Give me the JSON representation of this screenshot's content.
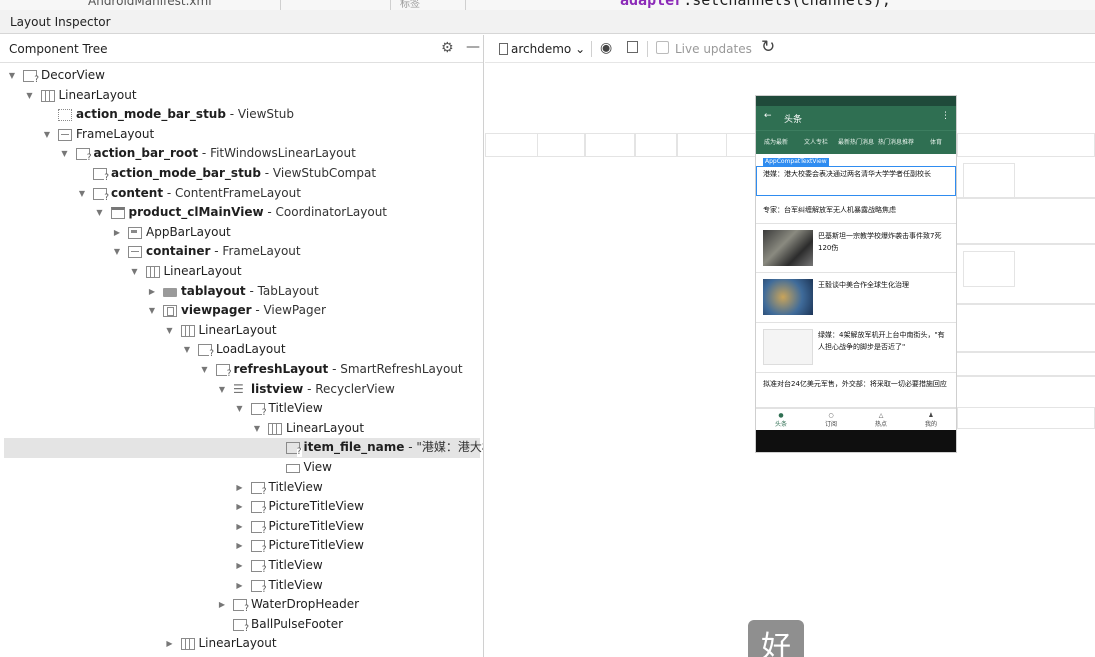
{
  "editor": {
    "file_tab": "AndroidManifest.xml",
    "cn_hint": "标签",
    "code_keyword": "adapter",
    "code_rest": ".setChannels(channels);"
  },
  "tool_window": {
    "title": "Layout Inspector"
  },
  "component_tree": {
    "header": "Component Tree",
    "rows": [
      {
        "depth": 0,
        "toggle": "▼",
        "icon": "q",
        "name": "DecorView",
        "bold": false,
        "cls": ""
      },
      {
        "depth": 1,
        "toggle": "▼",
        "icon": "lin",
        "name": "LinearLayout",
        "bold": false,
        "cls": ""
      },
      {
        "depth": 2,
        "toggle": "",
        "icon": "stub",
        "name": "action_mode_bar_stub",
        "bold": true,
        "cls": " - ViewStub"
      },
      {
        "depth": 2,
        "toggle": "▼",
        "icon": "frame",
        "name": "FrameLayout",
        "bold": false,
        "cls": ""
      },
      {
        "depth": 3,
        "toggle": "▼",
        "icon": "q",
        "name": "action_bar_root",
        "bold": true,
        "cls": " - FitWindowsLinearLayout"
      },
      {
        "depth": 4,
        "toggle": "",
        "icon": "q",
        "name": "action_mode_bar_stub",
        "bold": true,
        "cls": " - ViewStubCompat"
      },
      {
        "depth": 4,
        "toggle": "▼",
        "icon": "q",
        "name": "content",
        "bold": true,
        "cls": " - ContentFrameLayout"
      },
      {
        "depth": 5,
        "toggle": "▼",
        "icon": "coord",
        "name": "product_clMainView",
        "bold": true,
        "cls": " - CoordinatorLayout"
      },
      {
        "depth": 6,
        "toggle": "▶",
        "icon": "bar",
        "name": "AppBarLayout",
        "bold": false,
        "cls": ""
      },
      {
        "depth": 6,
        "toggle": "▼",
        "icon": "frame",
        "name": "container",
        "bold": true,
        "cls": " - FrameLayout"
      },
      {
        "depth": 7,
        "toggle": "▼",
        "icon": "lin",
        "name": "LinearLayout",
        "bold": false,
        "cls": ""
      },
      {
        "depth": 8,
        "toggle": "▶",
        "icon": "folder",
        "name": "tablayout",
        "bold": true,
        "cls": " - TabLayout"
      },
      {
        "depth": 8,
        "toggle": "▼",
        "icon": "pager",
        "name": "viewpager",
        "bold": true,
        "cls": " - ViewPager"
      },
      {
        "depth": 9,
        "toggle": "▼",
        "icon": "lin",
        "name": "LinearLayout",
        "bold": false,
        "cls": ""
      },
      {
        "depth": 10,
        "toggle": "▼",
        "icon": "q",
        "name": "LoadLayout",
        "bold": false,
        "cls": ""
      },
      {
        "depth": 11,
        "toggle": "▼",
        "icon": "q",
        "name": "refreshLayout",
        "bold": true,
        "cls": " - SmartRefreshLayout"
      },
      {
        "depth": 12,
        "toggle": "▼",
        "icon": "list",
        "name": "listview",
        "bold": true,
        "cls": " - RecyclerView"
      },
      {
        "depth": 13,
        "toggle": "▼",
        "icon": "q",
        "name": "TitleView",
        "bold": false,
        "cls": ""
      },
      {
        "depth": 14,
        "toggle": "▼",
        "icon": "lin",
        "name": "LinearLayout",
        "bold": false,
        "cls": ""
      },
      {
        "depth": 15,
        "toggle": "",
        "icon": "q",
        "name": "item_file_name",
        "bold": true,
        "cls": " - \"港媒：港大校",
        "selected": true
      },
      {
        "depth": 15,
        "toggle": "",
        "icon": "view",
        "name": "View",
        "bold": false,
        "cls": ""
      },
      {
        "depth": 13,
        "toggle": "▶",
        "icon": "q",
        "name": "TitleView",
        "bold": false,
        "cls": ""
      },
      {
        "depth": 13,
        "toggle": "▶",
        "icon": "q",
        "name": "PictureTitleView",
        "bold": false,
        "cls": ""
      },
      {
        "depth": 13,
        "toggle": "▶",
        "icon": "q",
        "name": "PictureTitleView",
        "bold": false,
        "cls": ""
      },
      {
        "depth": 13,
        "toggle": "▶",
        "icon": "q",
        "name": "PictureTitleView",
        "bold": false,
        "cls": ""
      },
      {
        "depth": 13,
        "toggle": "▶",
        "icon": "q",
        "name": "TitleView",
        "bold": false,
        "cls": ""
      },
      {
        "depth": 13,
        "toggle": "▶",
        "icon": "q",
        "name": "TitleView",
        "bold": false,
        "cls": ""
      },
      {
        "depth": 12,
        "toggle": "▶",
        "icon": "q",
        "name": "WaterDropHeader",
        "bold": false,
        "cls": ""
      },
      {
        "depth": 12,
        "toggle": "",
        "icon": "q",
        "name": "BallPulseFooter",
        "bold": false,
        "cls": ""
      },
      {
        "depth": 9,
        "toggle": "▶",
        "icon": "lin",
        "name": "LinearLayout",
        "bold": false,
        "cls": ""
      }
    ]
  },
  "inspector_toolbar": {
    "process": "archdemo",
    "live_updates": "Live updates"
  },
  "phone": {
    "title": "头条",
    "back": "←",
    "menu": "⋮",
    "tabs": [
      "成为最新",
      "文人专栏",
      "最新热门消息",
      "热门消息推荐",
      "体育"
    ],
    "selected_tag": "AppCompatTextView",
    "items": [
      {
        "text": "港媒：港大校委会表决通过两名清华大学学者任副校长"
      },
      {
        "text": "专家：台军纠缠解放军无人机暴露战略焦虑"
      },
      {
        "text": "巴基斯坦一宗教学校爆炸袭击事件致7死120伤"
      },
      {
        "text": "王毅谈中美合作全球生化治理"
      },
      {
        "text": "绿媒：4架解放军机开上台中南街头，\"有人担心战争的脚步是否近了\""
      },
      {
        "text": "拟准对台24亿美元军售，外交部：将采取一切必要措施回应"
      }
    ],
    "nav": [
      {
        "icon": "●",
        "label": "头条"
      },
      {
        "icon": "○",
        "label": "订阅"
      },
      {
        "icon": "△",
        "label": "热点"
      },
      {
        "icon": "♟",
        "label": "我的"
      }
    ]
  },
  "ime_char": "好"
}
